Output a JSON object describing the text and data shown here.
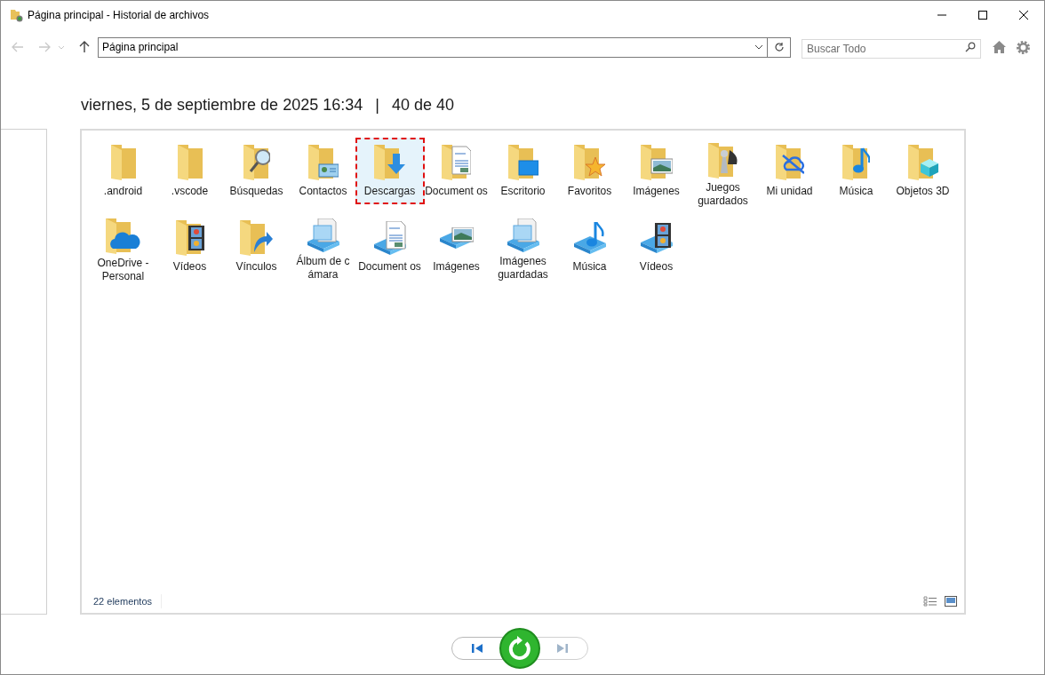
{
  "window": {
    "title": "Página principal - Historial de archivos"
  },
  "address": {
    "value": "Página principal"
  },
  "search": {
    "placeholder": "Buscar Todo"
  },
  "header": {
    "date": "viernes, 5 de septiembre de 2025 16:34",
    "separator": "|",
    "position": "40 de 40"
  },
  "items": [
    {
      "label": ".android",
      "kind": "plain",
      "library": false,
      "selected": false
    },
    {
      "label": ".vscode",
      "kind": "plain",
      "library": false,
      "selected": false
    },
    {
      "label": "Búsquedas",
      "kind": "search",
      "library": false,
      "selected": false
    },
    {
      "label": "Contactos",
      "kind": "contact",
      "library": false,
      "selected": false
    },
    {
      "label": "Descargas",
      "kind": "download",
      "library": false,
      "selected": true
    },
    {
      "label": "Document os",
      "kind": "document",
      "library": false,
      "selected": false
    },
    {
      "label": "Escritorio",
      "kind": "desktop",
      "library": false,
      "selected": false
    },
    {
      "label": "Favoritos",
      "kind": "star",
      "library": false,
      "selected": false
    },
    {
      "label": "Imágenes",
      "kind": "picture",
      "library": false,
      "selected": false
    },
    {
      "label": "Juegos guardados",
      "kind": "game",
      "library": false,
      "selected": false
    },
    {
      "label": "Mi unidad",
      "kind": "cloudoff",
      "library": false,
      "selected": false
    },
    {
      "label": "Música",
      "kind": "music",
      "library": false,
      "selected": false
    },
    {
      "label": "Objetos 3D",
      "kind": "cube",
      "library": false,
      "selected": false
    },
    {
      "label": "OneDrive - Personal",
      "kind": "cloud",
      "library": false,
      "selected": false
    },
    {
      "label": "Vídeos",
      "kind": "film",
      "library": false,
      "selected": false
    },
    {
      "label": "Vínculos",
      "kind": "link",
      "library": false,
      "selected": false
    },
    {
      "label": "Álbum de c ámara",
      "kind": "pages",
      "library": true,
      "selected": false
    },
    {
      "label": "Document os",
      "kind": "document",
      "library": true,
      "selected": false
    },
    {
      "label": "Imágenes",
      "kind": "picture",
      "library": true,
      "selected": false
    },
    {
      "label": "Imágenes guardadas",
      "kind": "pages",
      "library": true,
      "selected": false
    },
    {
      "label": "Música",
      "kind": "music",
      "library": true,
      "selected": false
    },
    {
      "label": "Vídeos",
      "kind": "film",
      "library": true,
      "selected": false
    }
  ],
  "status_bar": {
    "count": "22 elementos"
  }
}
